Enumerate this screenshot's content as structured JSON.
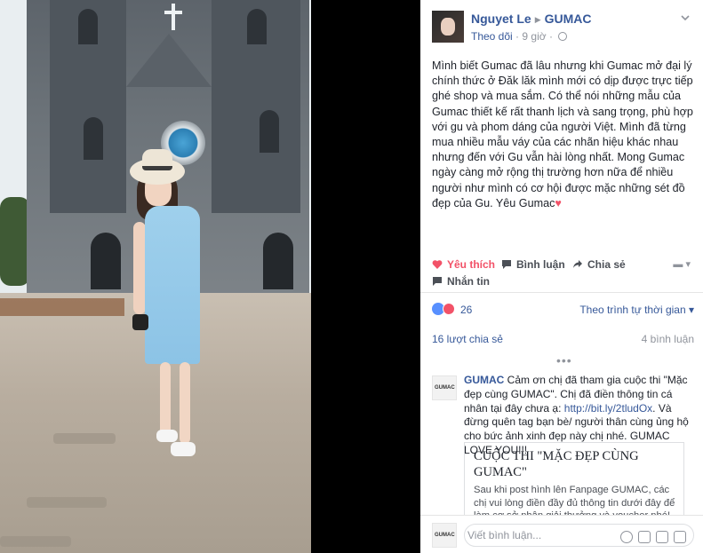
{
  "post": {
    "author": "Nguyet Le",
    "page": "GUMAC",
    "follow": "Theo dõi",
    "time": "9 giờ",
    "body": "Mình biết Gumac đã lâu nhưng khi Gumac mở đại lý chính thức ở Đăk lăk mình mới có dịp được trực tiếp ghé shop và mua sắm. Có thể nói những mẫu của Gumac thiết kế rất thanh lịch và sang trọng, phù hợp với gu và phom dáng của người Việt. Mình đã từng mua nhiều mẫu váy của các nhãn hiệu khác nhau nhưng đến với Gu vẫn hài lòng nhất. Mong Gumac ngày càng mở rộng thị trường hơn nữa để nhiều người như mình có cơ hội được mặc những sét đồ đẹp của Gu. Yêu Gumac",
    "heart": "♥"
  },
  "actions": {
    "like": "Yêu thích",
    "comment": "Bình luận",
    "share": "Chia sẻ",
    "save": "Nhắn tin"
  },
  "stats": {
    "reactions": "26",
    "order": "Theo trình tự thời gian ▾",
    "shares": "16 lượt chia sẻ",
    "comments": "4 bình luận",
    "more": "•••"
  },
  "comment": {
    "avatar_text": "GUMAC",
    "name": "GUMAC",
    "text_1": " Cảm ơn chị đã tham gia cuộc thi \"Mặc đẹp cùng GUMAC\". Chị đã điền thông tin cá nhân tại đây chưa ạ: ",
    "link": "http://bit.ly/2tludOx",
    "text_2": ". Và đừng quên tag bạn bè/ người thân cùng ủng hộ cho bức ảnh xinh đẹp này chị nhé. GUMAC LOVE YOU!!!"
  },
  "card": {
    "title": "CUỘC THI \"MẶC ĐẸP CÙNG GUMAC\"",
    "desc": "Sau khi post hình lên Fanpage GUMAC, các chị vui lòng điền đầy đủ thông tin dưới đây để làm cơ sở nhận giải thưởng và voucher nhé!"
  },
  "composer": {
    "avatar_text": "GUMAC",
    "placeholder": "Viết bình luận..."
  },
  "colors": {
    "link": "#365899",
    "like": "#f25268",
    "muted": "#90949c"
  }
}
